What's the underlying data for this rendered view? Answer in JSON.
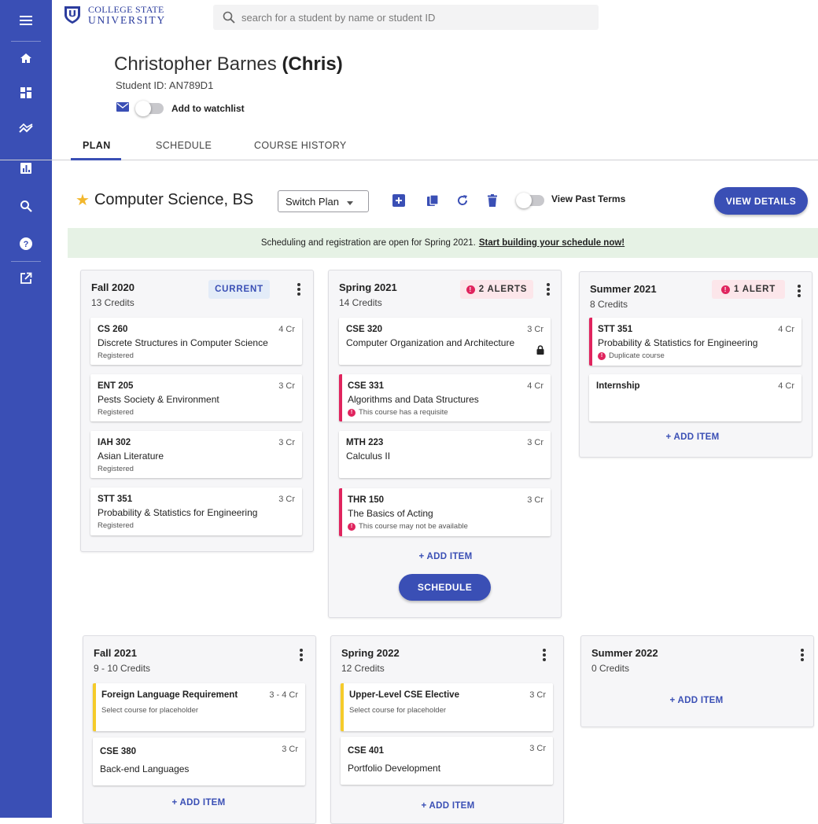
{
  "app": {
    "logo_line1": "COLLEGE STATE",
    "logo_line2": "UNIVERSITY",
    "search_placeholder": "search for a student by name or student ID",
    "accent_color": "#3a4fb5",
    "alert_color": "#e0245e",
    "placeholder_color": "#f5cb2a"
  },
  "rail": {
    "icons": [
      "menu-icon",
      "home-icon",
      "dashboard-icon",
      "trending-icon",
      "bar-chart-icon",
      "search-icon",
      "help-icon",
      "open-in-new-icon"
    ]
  },
  "student": {
    "name_first": "Christopher Barnes",
    "name_nick": "(Chris)",
    "id_text": "Student ID: AN789D1",
    "watchlist_label": "Add to watchlist"
  },
  "tabs": [
    "PLAN",
    "SCHEDULE",
    "COURSE HISTORY"
  ],
  "plan": {
    "title": "Computer Science, BS",
    "switch_plan": "Switch Plan",
    "view_past_terms": "View Past Terms",
    "view_details": "VIEW DETAILS"
  },
  "banner": {
    "text": "Scheduling and registration are open for Spring 2021.",
    "link": "Start building your schedule now!"
  },
  "common": {
    "add_item": "+ ADD ITEM",
    "schedule": "SCHEDULE"
  },
  "terms": [
    {
      "title": "Fall 2020",
      "credits": "13 Credits",
      "chip": "CURRENT",
      "courses": [
        {
          "code": "CS 260",
          "credits": "4 Cr",
          "name": "Discrete Structures in Computer Science",
          "status": "Registered"
        },
        {
          "code": "ENT 205",
          "credits": "3 Cr",
          "name": "Pests Society & Environment",
          "status": "Registered"
        },
        {
          "code": "IAH 302",
          "credits": "3 Cr",
          "name": "Asian Literature",
          "status": "Registered"
        },
        {
          "code": "STT 351",
          "credits": "3 Cr",
          "name": "Probability & Statistics for Engineering",
          "status": "Registered"
        }
      ]
    },
    {
      "title": "Spring 2021",
      "credits": "14 Credits",
      "chip": "2 ALERTS",
      "courses": [
        {
          "code": "CSE 320",
          "credits": "3 Cr",
          "name": "Computer Organization and Architecture",
          "status": ""
        },
        {
          "code": "CSE 331",
          "credits": "4 Cr",
          "name": "Algorithms and Data Structures",
          "status": "This course has a requisite"
        },
        {
          "code": "MTH 223",
          "credits": "3 Cr",
          "name": "Calculus II",
          "status": ""
        },
        {
          "code": "THR 150",
          "credits": "3 Cr",
          "name": "The Basics of Acting",
          "status": "This course may not be available"
        }
      ]
    },
    {
      "title": "Summer 2021",
      "credits": "8 Credits",
      "chip": "1 ALERT",
      "courses": [
        {
          "code": "STT 351",
          "credits": "4 Cr",
          "name": "Probability & Statistics for Engineering",
          "status": "Duplicate course"
        },
        {
          "code": "Internship",
          "credits": "4 Cr",
          "name": "",
          "status": ""
        }
      ]
    },
    {
      "title": "Fall 2021",
      "credits": "9 - 10 Credits",
      "courses": [
        {
          "code": "Foreign Language Requirement",
          "credits": "3 - 4 Cr",
          "name": "",
          "status": "Select course for placeholder"
        },
        {
          "code": "CSE 380",
          "credits": "3 Cr",
          "name": "Back-end Languages",
          "status": ""
        }
      ]
    },
    {
      "title": "Spring 2022",
      "credits": "12 Credits",
      "courses": [
        {
          "code": "Upper-Level CSE Elective",
          "credits": "3 Cr",
          "name": "",
          "status": "Select course for placeholder"
        },
        {
          "code": "CSE 401",
          "credits": "3 Cr",
          "name": "Portfolio Development",
          "status": ""
        }
      ]
    },
    {
      "title": "Summer 2022",
      "credits": "0 Credits",
      "courses": []
    }
  ]
}
